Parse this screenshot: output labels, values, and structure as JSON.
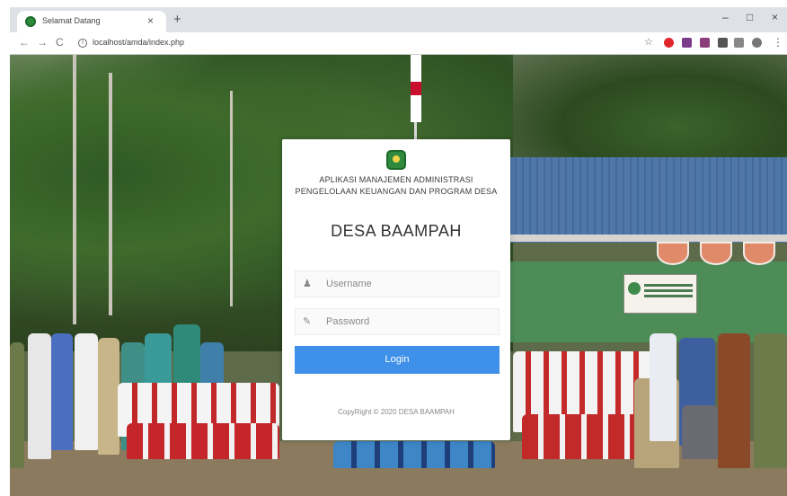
{
  "browser": {
    "tab_title": "Selamat Datang",
    "tab_close": "×",
    "new_tab": "+",
    "url": "localhost/amda/index.php",
    "window_controls": [
      "–",
      "□",
      "×"
    ],
    "nav": {
      "back": "←",
      "forward": "→",
      "reload": "C"
    },
    "icons": [
      "back-icon",
      "forward-icon",
      "reload-icon",
      "info-icon",
      "star-icon",
      "opera-icon",
      "extension-icon",
      "puzzle-icon",
      "menu-icon"
    ]
  },
  "login": {
    "app_title": "APLIKASI MANAJEMEN ADMINISTRASI PENGELOLAAN KEUANGAN DAN PROGRAM DESA",
    "desa_title": "DESA BAAMPAH",
    "username_placeholder": "Username",
    "password_placeholder": "Password",
    "login_label": "Login",
    "copyright": "CopyRight © 2020 DESA BAAMPAH",
    "username_icon": "user-icon",
    "password_icon": "pencil-icon"
  },
  "colors": {
    "login_button": "#3f90e8",
    "card_background": "#ffffff",
    "logo_green": "#2e8b3e"
  }
}
